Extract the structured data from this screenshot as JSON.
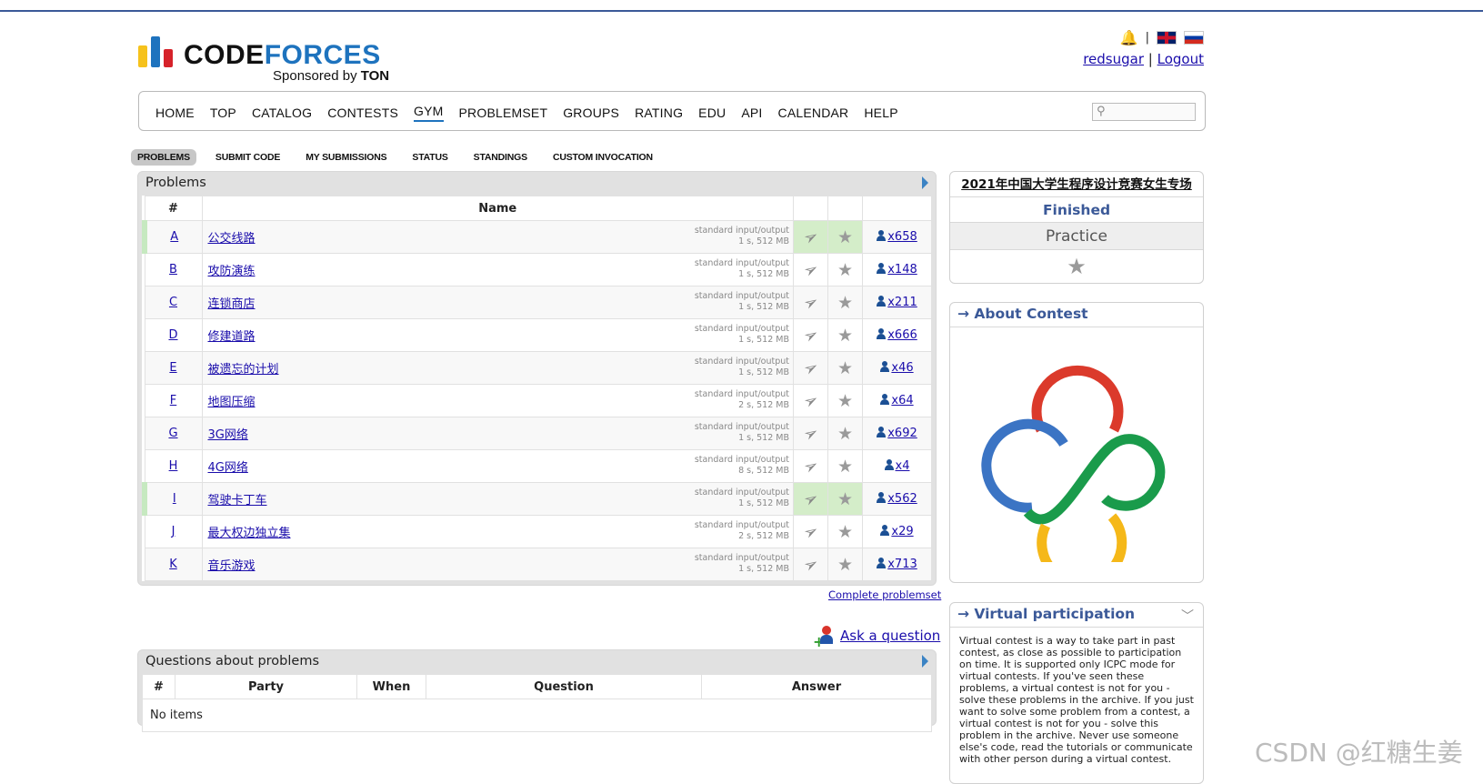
{
  "header": {
    "logo_word_a": "CODE",
    "logo_word_b": "FORCES",
    "sponsor_prefix": "Sponsored by ",
    "sponsor_name": "TON",
    "separator": "|",
    "user": "redsugar",
    "logout": "Logout"
  },
  "mainnav": [
    "HOME",
    "TOP",
    "CATALOG",
    "CONTESTS",
    "GYM",
    "PROBLEMSET",
    "GROUPS",
    "RATING",
    "EDU",
    "API",
    "CALENDAR",
    "HELP"
  ],
  "subnav": [
    "PROBLEMS",
    "SUBMIT CODE",
    "MY SUBMISSIONS",
    "STATUS",
    "STANDINGS",
    "CUSTOM INVOCATION"
  ],
  "problems": {
    "title": "Problems",
    "col_num": "#",
    "col_name": "Name",
    "rows": [
      {
        "letter": "A",
        "name": "公交线路",
        "io": "standard input/output",
        "limits": "1 s, 512 MB",
        "solved": "x658",
        "accepted": true
      },
      {
        "letter": "B",
        "name": "攻防演练",
        "io": "standard input/output",
        "limits": "1 s, 512 MB",
        "solved": "x148",
        "accepted": false
      },
      {
        "letter": "C",
        "name": "连锁商店",
        "io": "standard input/output",
        "limits": "1 s, 512 MB",
        "solved": "x211",
        "accepted": false
      },
      {
        "letter": "D",
        "name": "修建道路",
        "io": "standard input/output",
        "limits": "1 s, 512 MB",
        "solved": "x666",
        "accepted": false
      },
      {
        "letter": "E",
        "name": "被遗忘的计划",
        "io": "standard input/output",
        "limits": "1 s, 512 MB",
        "solved": "x46",
        "accepted": false
      },
      {
        "letter": "F",
        "name": "地图压缩",
        "io": "standard input/output",
        "limits": "2 s, 512 MB",
        "solved": "x64",
        "accepted": false
      },
      {
        "letter": "G",
        "name": "3G网络",
        "io": "standard input/output",
        "limits": "1 s, 512 MB",
        "solved": "x692",
        "accepted": false
      },
      {
        "letter": "H",
        "name": "4G网络",
        "io": "standard input/output",
        "limits": "8 s, 512 MB",
        "solved": "x4",
        "accepted": false
      },
      {
        "letter": "I",
        "name": "驾驶卡丁车",
        "io": "standard input/output",
        "limits": "1 s, 512 MB",
        "solved": "x562",
        "accepted": true
      },
      {
        "letter": "J",
        "name": "最大权边独立集",
        "io": "standard input/output",
        "limits": "2 s, 512 MB",
        "solved": "x29",
        "accepted": false
      },
      {
        "letter": "K",
        "name": "音乐游戏",
        "io": "standard input/output",
        "limits": "1 s, 512 MB",
        "solved": "x713",
        "accepted": false
      }
    ],
    "complete_link": "Complete problemset"
  },
  "ask_question": "Ask a question",
  "questions": {
    "title": "Questions about problems",
    "cols": [
      "#",
      "Party",
      "When",
      "Question",
      "Answer"
    ],
    "empty": "No items"
  },
  "sidebar": {
    "contest_name": "2021年中国大学生程序设计竞赛女生专场",
    "status": "Finished",
    "phase": "Practice",
    "about_title": "→ About Contest",
    "virtual_title": "→ Virtual participation",
    "virtual_text": "Virtual contest is a way to take part in past contest, as close as possible to participation on time. It is supported only ICPC mode for virtual contests. If you've seen these problems, a virtual contest is not for you - solve these problems in the archive. If you just want to solve some problem from a contest, a virtual contest is not for you - solve this problem in the archive. Never use someone else's code, read the tutorials or communicate with other person during a virtual contest."
  },
  "watermark": "CSDN @红糖生姜",
  "colors": {
    "accent": "#3b5998",
    "link": "#1a0dab",
    "accepted": "#d4edc9",
    "ring_red": "#db3a2b",
    "ring_blue": "#3b74c4",
    "ring_green": "#1a9b4b",
    "ring_yellow": "#f5b819"
  }
}
